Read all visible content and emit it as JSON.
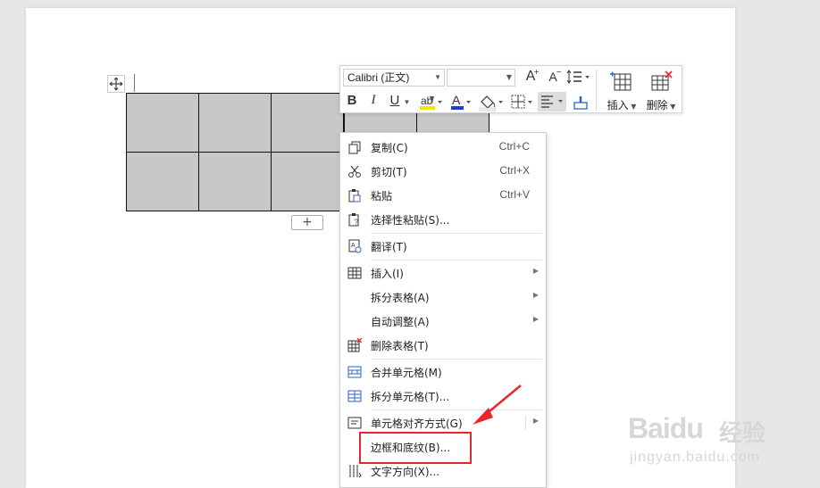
{
  "toolbar": {
    "font_name": "Calibri (正文)",
    "font_size": "",
    "bold": "B",
    "italic": "I",
    "underline": "U",
    "font_color_letter": "A",
    "grow_font": "A",
    "shrink_font": "A",
    "insert_label": "插入",
    "delete_label": "删除"
  },
  "table": {
    "add_row": "+"
  },
  "context_menu": {
    "items": [
      {
        "label": "复制(C)",
        "shortcut": "Ctrl+C",
        "icon": "copy-icon"
      },
      {
        "label": "剪切(T)",
        "shortcut": "Ctrl+X",
        "icon": "scissors-icon"
      },
      {
        "label": "粘贴",
        "shortcut": "Ctrl+V",
        "icon": "paste-icon"
      },
      {
        "label": "选择性粘贴(S)...",
        "shortcut": "",
        "icon": "paste-special-icon"
      },
      {
        "label": "翻译(T)",
        "shortcut": "",
        "icon": "translate-icon"
      },
      {
        "label": "插入(I)",
        "shortcut": "",
        "icon": "table-insert-icon"
      },
      {
        "label": "拆分表格(A)",
        "shortcut": "",
        "icon": ""
      },
      {
        "label": "自动调整(A)",
        "shortcut": "",
        "icon": ""
      },
      {
        "label": "删除表格(T)",
        "shortcut": "",
        "icon": "table-delete-icon"
      },
      {
        "label": "合并单元格(M)",
        "shortcut": "",
        "icon": "merge-cells-icon"
      },
      {
        "label": "拆分单元格(T)...",
        "shortcut": "",
        "icon": "split-cells-icon"
      },
      {
        "label": "单元格对齐方式(G)",
        "shortcut": "",
        "icon": "cell-align-icon"
      },
      {
        "label": "边框和底纹(B)...",
        "shortcut": "",
        "icon": ""
      },
      {
        "label": "文字方向(X)...",
        "shortcut": "",
        "icon": "text-direction-icon"
      }
    ]
  },
  "watermark": {
    "logo": "Baidu",
    "cn": "经验",
    "url": "jingyan.baidu.com"
  },
  "colors": {
    "highlight": "#e8262b",
    "cell_fill": "#c8c8c8",
    "font_color_bar": "#1a3fd1",
    "highlight_color_bar": "#f2e600"
  }
}
